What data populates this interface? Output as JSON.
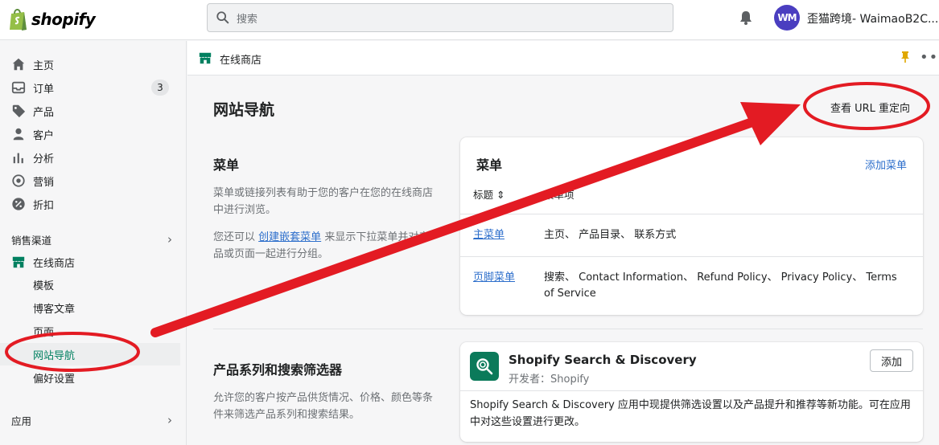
{
  "topbar": {
    "logo_text": "shopify",
    "search_placeholder": "搜索",
    "avatar_initials": "WM",
    "store_name": "歪猫跨境- WaimaoB2C...."
  },
  "sidebar": {
    "items": [
      {
        "label": "主页",
        "icon": "home-icon"
      },
      {
        "label": "订单",
        "icon": "inbox-icon",
        "badge": "3"
      },
      {
        "label": "产品",
        "icon": "tag-icon"
      },
      {
        "label": "客户",
        "icon": "person-icon"
      },
      {
        "label": "分析",
        "icon": "bar-chart-icon"
      },
      {
        "label": "营销",
        "icon": "target-icon"
      },
      {
        "label": "折扣",
        "icon": "discount-icon"
      }
    ],
    "sales_channels_label": "销售渠道",
    "online_store_label": "在线商店",
    "sub_items": [
      "模板",
      "博客文章",
      "页面",
      "网站导航",
      "偏好设置"
    ],
    "apps_label": "应用"
  },
  "page_header": {
    "title": "在线商店"
  },
  "main": {
    "title": "网站导航",
    "url_redirect_label": "查看 URL 重定向",
    "menus_section": {
      "title": "菜单",
      "desc1": "菜单或链接列表有助于您的客户在您的在线商店中进行浏览。",
      "desc2_prefix": "您还可以",
      "desc2_link": "创建嵌套菜单",
      "desc2_suffix": "来显示下拉菜单并对产品或页面一起进行分组。"
    },
    "menus_card": {
      "title": "菜单",
      "add_menu_label": "添加菜单",
      "col_title": "标题 ⇕",
      "col_items": "菜单项",
      "rows": [
        {
          "name": "主菜单",
          "items": "主页、 产品目录、 联系方式"
        },
        {
          "name": "页脚菜单",
          "items": "搜索、 Contact Information、 Refund Policy、 Privacy Policy、 Terms of Service"
        }
      ]
    },
    "filters_section": {
      "title": "产品系列和搜索筛选器",
      "desc": "允许您的客户按产品供货情况、价格、颜色等条件来筛选产品系列和搜索结果。"
    },
    "app_card": {
      "name": "Shopify Search & Discovery",
      "developer": "开发者：Shopify",
      "add_label": "添加",
      "description": "Shopify Search & Discovery 应用中现提供筛选设置以及产品提升和推荐等新功能。可在应用中对这些设置进行更改。"
    }
  },
  "colors": {
    "accent_green": "#008060",
    "link_blue": "#2c6ecb",
    "annotation_red": "#e31b23"
  }
}
